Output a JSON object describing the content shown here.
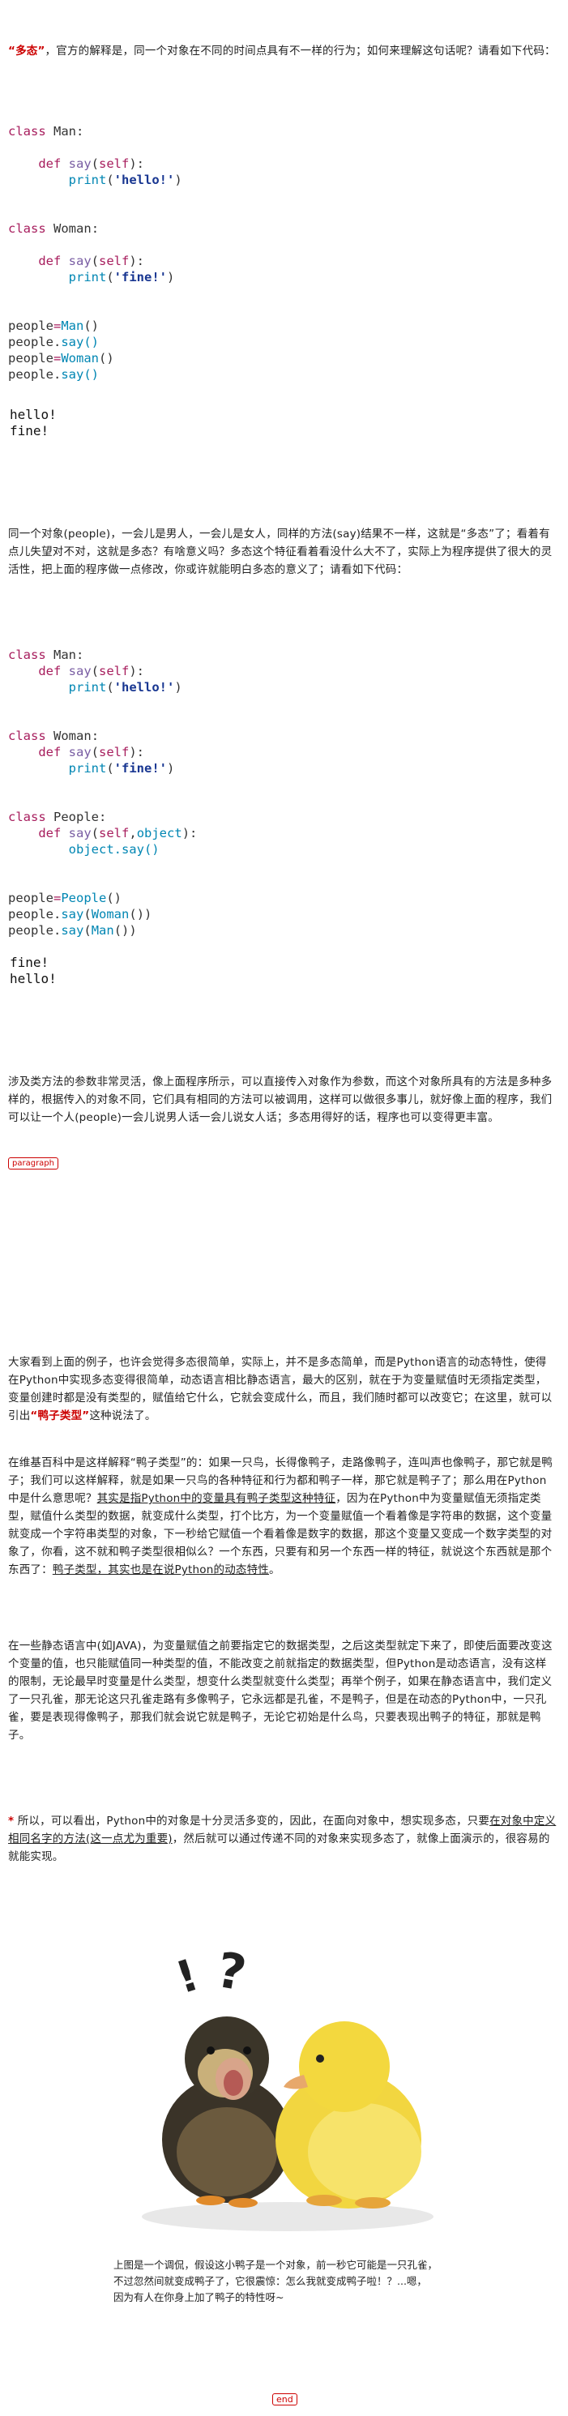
{
  "intro": {
    "quote": "“多态”",
    "rest": "，官方的解释是，同一个对象在不同的时间点具有不一样的行为；如何来理解这句话呢？请看如下代码："
  },
  "code1": {
    "class_man": "Man",
    "class_woman": "Woman",
    "def": "def",
    "say": "say",
    "self": "self",
    "print": "print",
    "hello": "'hello!'",
    "fine": "'fine!'",
    "class_kw": "class",
    "people": "people",
    "say_call": "say()"
  },
  "output1": [
    "hello!",
    "fine!"
  ],
  "para2": "同一个对象(people)，一会儿是男人，一会儿是女人，同样的方法(say)结果不一样，这就是“多态”了；看着有点儿失望对不对，这就是多态？有啥意义吗？多态这个特征看着看没什么大不了，实际上为程序提供了很大的灵活性，把上面的程序做一点修改，你或许就能明白多态的意义了；请看如下代码：",
  "code2": {
    "class_people": "People",
    "object": "object",
    "object_say": "object.say()"
  },
  "output2": [
    "fine!",
    "hello!"
  ],
  "para3": "涉及类方法的参数非常灵活，像上面程序所示，可以直接传入对象作为参数，而这个对象所具有的方法是多种多样的，根据传入的对象不同，它们具有相同的方法可以被调用，这样可以做很多事儿，就好像上面的程序，我们可以让一个人(people)一会儿说男人话一会儿说女人话；多态用得好的话，程序也可以变得更丰富。",
  "tag_paragraph": "paragraph",
  "para4": {
    "a": "大家看到上面的例子，也许会觉得多态很简单，实际上，并不是多态简单，而是Python语言的动态特性，使得在Python中实现多态变得很简单，动态语言相比静态语言，最大的区别，就在于为变量赋值时无须指定类型，变量创建时都是没有类型的，赋值给它什么，它就会变成什么，而且，我们随时都可以改变它；在这里，就可以引出",
    "red": "“鸭子类型”",
    "b": "这种说法了。"
  },
  "para5": {
    "a": "在维基百科中是这样解释“鸭子类型”的：如果一只鸟，长得像鸭子，走路像鸭子，连叫声也像鸭子，那它就是鸭子；我们可以这样解释，就是如果一只鸟的各种特征和行为都和鸭子一样，那它就是鸭子了；那么用在Python中是什么意思呢？",
    "u1": "其实是指Python中的变量具有鸭子类型这种特征",
    "b": "，因为在Python中为变量赋值无须指定类型，赋值什么类型的数据，就变成什么类型，打个比方，为一个变量赋值一个看着像是字符串的数据，这个变量就变成一个字符串类型的对象，下一秒给它赋值一个看着像是数字的数据，那这个变量又变成一个数字类型的对象了，你看，这不就和鸭子类型很相似么？一个东西，只要有和另一个东西一样的特征，就说这个东西就是那个东西了：",
    "u2": "鸭子类型，其实也是在说Python的动态特性",
    "c": "。"
  },
  "para6": "在一些静态语言中(如JAVA)，为变量赋值之前要指定它的数据类型，之后这类型就定下来了，即使后面要改变这个变量的值，也只能赋值同一种类型的值，不能改变之前就指定的数据类型，但Python是动态语言，没有这样的限制，无论最早时变量是什么类型，想变什么类型就变什么类型；再举个例子，如果在静态语言中，我们定义了一只孔雀，那无论这只孔雀走路有多像鸭子，它永远都是孔雀，不是鸭子，但是在动态的Python中，一只孔雀，要是表现得像鸭子，那我们就会说它就是鸭子，无论它初始是什么鸟，只要表现出鸭子的特征，那就是鸭子。",
  "para7": {
    "star": "*",
    "a": "所以，可以看出，Python中的对象是十分灵活多变的，因此，在面向对象中，想实现多态，只要",
    "u1": "在对象中定义相同名字的方法(这一点尤为重要)",
    "b": "，然后就可以通过传递不同的对象来实现多态了，就像上面演示的，很容易的就能实现。"
  },
  "image": {
    "marks": "!?"
  },
  "caption": [
    "上图是一个调侃，假设这小鸭子是一个对象，前一秒它可能是一只孔雀，",
    "不过忽然间就变成鸭子了，它很震惊：怎么我就变成鸭子啦！？...嗯，",
    "因为有人在你身上加了鸭子的特性呀~"
  ],
  "tag_end": "end",
  "colors": {
    "keyword": "#a71d5d",
    "string": "#183691",
    "builtin": "#0086b3",
    "accent_red": "#c00"
  }
}
